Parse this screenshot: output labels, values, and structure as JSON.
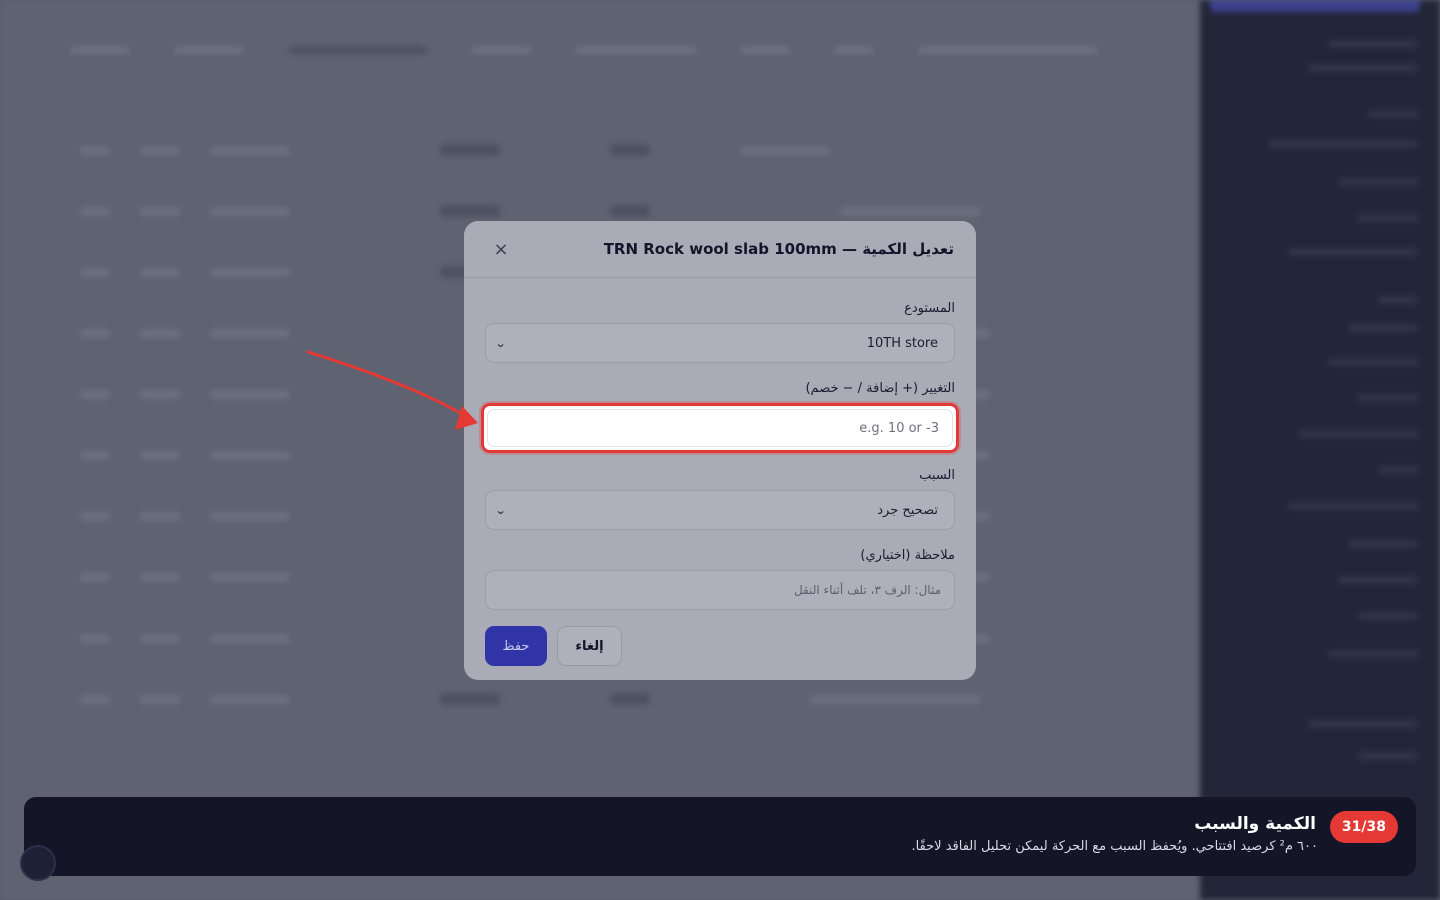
{
  "modal": {
    "title": "تعديل الكمية — TRN Rock wool slab 100mm",
    "close_symbol": "×",
    "warehouse": {
      "label": "المستودع",
      "value": "10TH store"
    },
    "change": {
      "label": "التغيير (+ إضافة / − خصم)",
      "placeholder": "e.g. 10 or -3",
      "value": ""
    },
    "reason": {
      "label": "السبب",
      "value": "تصحيح جرد"
    },
    "note": {
      "label": "ملاحظة (اختياري)",
      "placeholder": "مثال: الرف ٣، تلف أثناء النقل"
    },
    "buttons": {
      "save": "حفظ",
      "cancel": "إلغاء"
    }
  },
  "tour": {
    "step": "31/38",
    "title": "الكمية والسبب",
    "description": "٦٠٠ م² كرصيد افتتاحي. ويُحفظ السبب مع الحركة ليمكن تحليل الفاقد لاحقًا."
  },
  "colors": {
    "accent": "#3034a6",
    "highlight": "#e53935",
    "tour_bg": "#141628"
  }
}
